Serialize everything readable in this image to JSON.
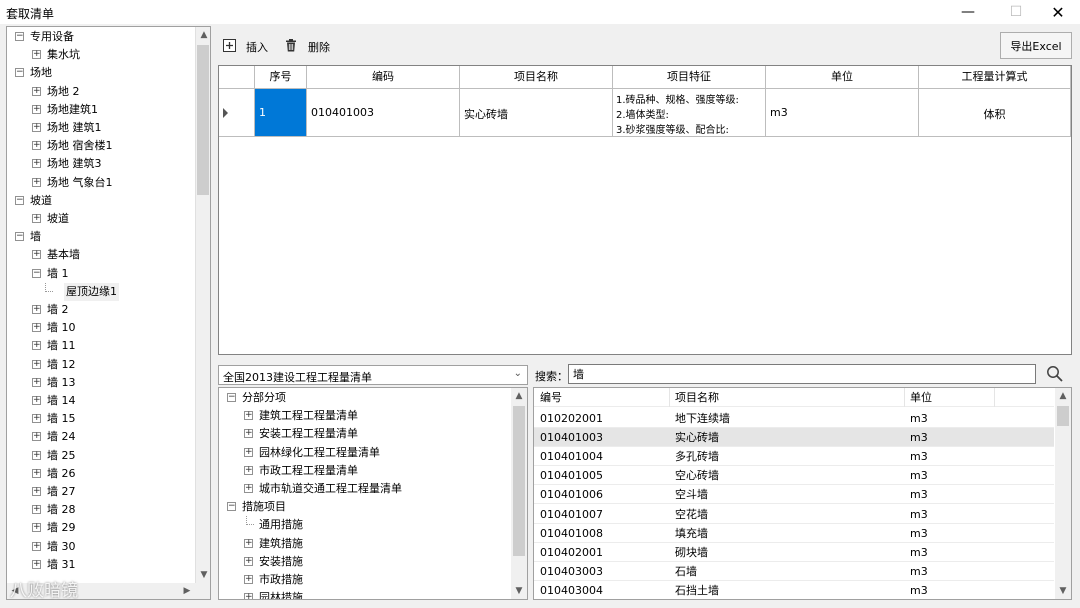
{
  "window": {
    "title": "套取清单"
  },
  "left_tree": {
    "items": [
      {
        "label": "专用设备",
        "level": 0,
        "expander": "−"
      },
      {
        "label": "集水坑",
        "level": 1,
        "expander": "+"
      },
      {
        "label": "场地",
        "level": 0,
        "expander": "−"
      },
      {
        "label": "场地 2",
        "level": 1,
        "expander": "+"
      },
      {
        "label": "场地建筑1",
        "level": 1,
        "expander": "+"
      },
      {
        "label": "场地 建筑1",
        "level": 1,
        "expander": "+"
      },
      {
        "label": "场地 宿舍楼1",
        "level": 1,
        "expander": "+"
      },
      {
        "label": "场地 建筑3",
        "level": 1,
        "expander": "+"
      },
      {
        "label": "场地 气象台1",
        "level": 1,
        "expander": "+"
      },
      {
        "label": "坡道",
        "level": 0,
        "expander": "−"
      },
      {
        "label": "坡道",
        "level": 1,
        "expander": "+"
      },
      {
        "label": "墙",
        "level": 0,
        "expander": "−"
      },
      {
        "label": "基本墙",
        "level": 1,
        "expander": "+"
      },
      {
        "label": "墙 1",
        "level": 1,
        "expander": "−"
      },
      {
        "label": "屋顶边缘1",
        "level": 2,
        "expander": "",
        "selected": true
      },
      {
        "label": "墙 2",
        "level": 1,
        "expander": "+"
      },
      {
        "label": "墙 10",
        "level": 1,
        "expander": "+"
      },
      {
        "label": "墙 11",
        "level": 1,
        "expander": "+"
      },
      {
        "label": "墙 12",
        "level": 1,
        "expander": "+"
      },
      {
        "label": "墙 13",
        "level": 1,
        "expander": "+"
      },
      {
        "label": "墙 14",
        "level": 1,
        "expander": "+"
      },
      {
        "label": "墙 15",
        "level": 1,
        "expander": "+"
      },
      {
        "label": "墙 24",
        "level": 1,
        "expander": "+"
      },
      {
        "label": "墙 25",
        "level": 1,
        "expander": "+"
      },
      {
        "label": "墙 26",
        "level": 1,
        "expander": "+"
      },
      {
        "label": "墙 27",
        "level": 1,
        "expander": "+"
      },
      {
        "label": "墙 28",
        "level": 1,
        "expander": "+"
      },
      {
        "label": "墙 29",
        "level": 1,
        "expander": "+"
      },
      {
        "label": "墙 30",
        "level": 1,
        "expander": "+"
      },
      {
        "label": "墙 31",
        "level": 1,
        "expander": "+"
      }
    ]
  },
  "toolbar": {
    "insert_label": "插入",
    "delete_label": "删除",
    "export_label": "导出Excel"
  },
  "grid": {
    "columns": [
      "序号",
      "编码",
      "项目名称",
      "项目特征",
      "单位",
      "工程量计算式"
    ],
    "rows": [
      {
        "index": "1",
        "code": "010401003",
        "name": "实心砖墙",
        "features": [
          "1.砖品种、规格、强度等级:",
          "2.墙体类型:",
          "3.砂浆强度等级、配合比:"
        ],
        "unit": "m3",
        "formula": "体积"
      }
    ]
  },
  "library": {
    "selected": "全国2013建设工程工程量清单",
    "tree": [
      {
        "label": "分部分项",
        "level": 0,
        "expander": "−"
      },
      {
        "label": "建筑工程工程量清单",
        "level": 1,
        "expander": "+"
      },
      {
        "label": "安装工程工程量清单",
        "level": 1,
        "expander": "+"
      },
      {
        "label": "园林绿化工程工程量清单",
        "level": 1,
        "expander": "+"
      },
      {
        "label": "市政工程工程量清单",
        "level": 1,
        "expander": "+"
      },
      {
        "label": "城市轨道交通工程工程量清单",
        "level": 1,
        "expander": "+"
      },
      {
        "label": "措施项目",
        "level": 0,
        "expander": "−"
      },
      {
        "label": "通用措施",
        "level": 1,
        "expander": ""
      },
      {
        "label": "建筑措施",
        "level": 1,
        "expander": "+"
      },
      {
        "label": "安装措施",
        "level": 1,
        "expander": "+"
      },
      {
        "label": "市政措施",
        "level": 1,
        "expander": "+"
      },
      {
        "label": "园林措施",
        "level": 1,
        "expander": "+"
      }
    ]
  },
  "search": {
    "label": "搜索：",
    "value": "墙"
  },
  "results": {
    "columns": [
      "编号",
      "项目名称",
      "单位"
    ],
    "rows": [
      {
        "code": "010202001",
        "name": "地下连续墙",
        "unit": "m3"
      },
      {
        "code": "010401003",
        "name": "实心砖墙",
        "unit": "m3",
        "highlight": true
      },
      {
        "code": "010401004",
        "name": "多孔砖墙",
        "unit": "m3"
      },
      {
        "code": "010401005",
        "name": "空心砖墙",
        "unit": "m3"
      },
      {
        "code": "010401006",
        "name": "空斗墙",
        "unit": "m3"
      },
      {
        "code": "010401007",
        "name": "空花墙",
        "unit": "m3"
      },
      {
        "code": "010401008",
        "name": "填充墙",
        "unit": "m3"
      },
      {
        "code": "010402001",
        "name": "砌块墙",
        "unit": "m3"
      },
      {
        "code": "010403003",
        "name": "石墙",
        "unit": "m3"
      },
      {
        "code": "010403004",
        "name": "石挡土墙",
        "unit": "m3"
      }
    ]
  },
  "watermark": "八败暗镜",
  "colors": {
    "selection_blue": "#0078d7",
    "row_highlight": "#e5e5e5"
  }
}
